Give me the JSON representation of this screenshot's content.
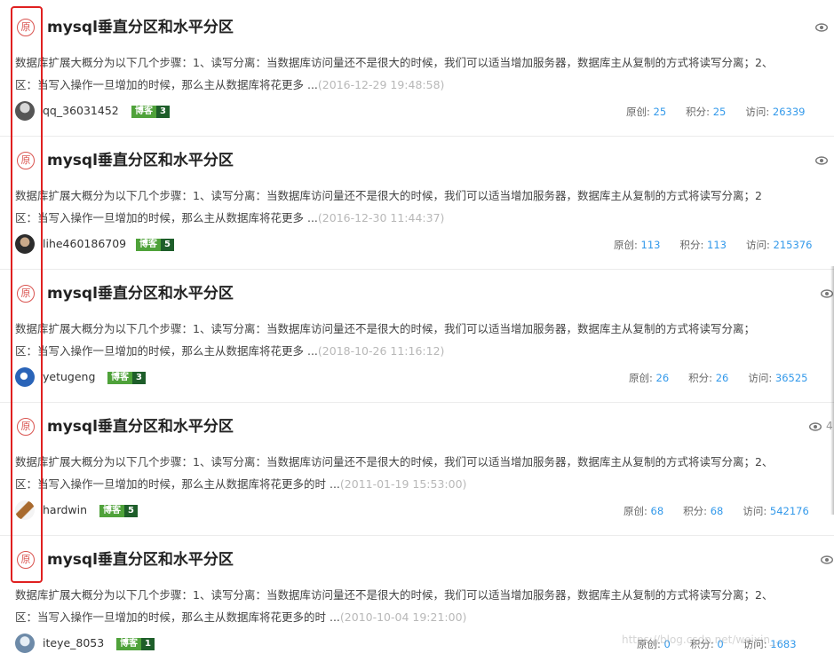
{
  "watermark": "https://blog.csdn.net/weixin_...",
  "annotation_color": "#e02020",
  "articles": [
    {
      "badge": "原",
      "title": "mysql垂直分区和水平分区",
      "eye_count": "",
      "desc_line1": "数据库扩展大概分为以下几个步骤：1、读写分离：当数据库访问量还不是很大的时候，我们可以适当增加服务器，数据库主从复制的方式将读写分离；2、",
      "desc_line2": "区：当写入操作一旦增加的时候，那么主从数据库将花更多 ...",
      "date": "(2016-12-29 19:48:58)",
      "user": "qq_36031452",
      "blog_label": "博客",
      "blog_level": "3",
      "yuanchuang_label": "原创:",
      "yuanchuang": "25",
      "jifen_label": "积分:",
      "jifen": "25",
      "fangwen_label": "访问:",
      "fangwen": "26339"
    },
    {
      "badge": "原",
      "title": "mysql垂直分区和水平分区",
      "eye_count": "",
      "desc_line1": "数据库扩展大概分为以下几个步骤：1、读写分离：当数据库访问量还不是很大的时候，我们可以适当增加服务器，数据库主从复制的方式将读写分离；2",
      "desc_line2": "区：当写入操作一旦增加的时候，那么主从数据库将花更多 ...",
      "date": "(2016-12-30 11:44:37)",
      "user": "lihe460186709",
      "blog_label": "博客",
      "blog_level": "5",
      "yuanchuang_label": "原创:",
      "yuanchuang": "113",
      "jifen_label": "积分:",
      "jifen": "113",
      "fangwen_label": "访问:",
      "fangwen": "215376"
    },
    {
      "badge": "原",
      "title": "mysql垂直分区和水平分区",
      "eye_count": "",
      "desc_line1": "数据库扩展大概分为以下几个步骤：1、读写分离：当数据库访问量还不是很大的时候，我们可以适当增加服务器，数据库主从复制的方式将读写分离；",
      "desc_line2": "区：当写入操作一旦增加的时候，那么主从数据库将花更多 ...",
      "date": "(2018-10-26 11:16:12)",
      "user": "yetugeng",
      "blog_label": "博客",
      "blog_level": "3",
      "yuanchuang_label": "原创:",
      "yuanchuang": "26",
      "jifen_label": "积分:",
      "jifen": "26",
      "fangwen_label": "访问:",
      "fangwen": "36525"
    },
    {
      "badge": "原",
      "title": "mysql垂直分区和水平分区",
      "eye_count": "4",
      "desc_line1": "数据库扩展大概分为以下几个步骤：1、读写分离：当数据库访问量还不是很大的时候，我们可以适当增加服务器，数据库主从复制的方式将读写分离；2、",
      "desc_line2": "区：当写入操作一旦增加的时候，那么主从数据库将花更多的时 ...",
      "date": "(2011-01-19 15:53:00)",
      "user": "hardwin",
      "blog_label": "博客",
      "blog_level": "5",
      "yuanchuang_label": "原创:",
      "yuanchuang": "68",
      "jifen_label": "积分:",
      "jifen": "68",
      "fangwen_label": "访问:",
      "fangwen": "542176"
    },
    {
      "badge": "原",
      "title": "mysql垂直分区和水平分区",
      "eye_count": "",
      "desc_line1": "数据库扩展大概分为以下几个步骤：1、读写分离：当数据库访问量还不是很大的时候，我们可以适当增加服务器，数据库主从复制的方式将读写分离；2、",
      "desc_line2": "区：当写入操作一旦增加的时候，那么主从数据库将花更多的时 ...",
      "date": "(2010-10-04 19:21:00)",
      "user": "iteye_8053",
      "blog_label": "博客",
      "blog_level": "1",
      "yuanchuang_label": "原创:",
      "yuanchuang": "0",
      "jifen_label": "积分:",
      "jifen": "0",
      "fangwen_label": "访问:",
      "fangwen": "1683"
    }
  ]
}
